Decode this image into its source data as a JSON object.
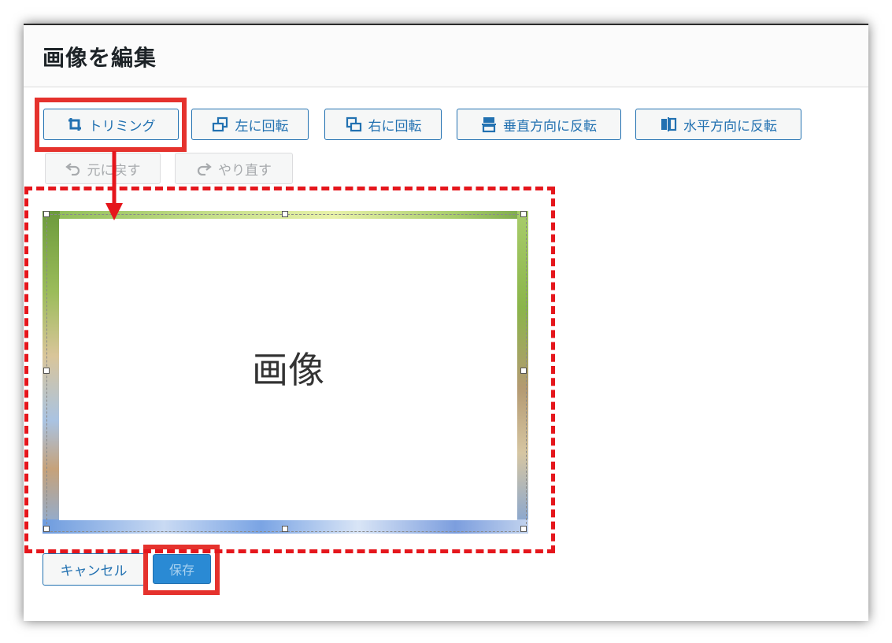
{
  "dialog": {
    "title": "画像を編集"
  },
  "toolbar": {
    "crop": "トリミング",
    "rotate_left": "左に回転",
    "rotate_right": "右に回転",
    "flip_vertical": "垂直方向に反転",
    "flip_horizontal": "水平方向に反転",
    "undo": "元に戻す",
    "redo": "やり直す"
  },
  "canvas": {
    "image_placeholder": "画像"
  },
  "actions": {
    "cancel": "キャンセル",
    "save": "保存"
  },
  "colors": {
    "accent": "#2271b1",
    "highlight": "#e5322d",
    "primary_button": "#2a8ad4",
    "disabled": "#a7aaad"
  }
}
